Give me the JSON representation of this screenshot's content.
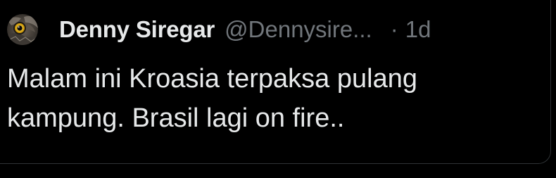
{
  "tweet": {
    "author": {
      "display_name": "Denny Siregar",
      "handle": "@Dennysire...",
      "avatar_icon": "owl-avatar-icon"
    },
    "separator": "·",
    "timestamp": "1d",
    "text": "Malam ini Kroasia terpaksa pulang kampung. Brasil lagi on fire.."
  },
  "colors": {
    "background": "#000000",
    "primary_text": "#e7e9ea",
    "secondary_text": "#71767b",
    "border": "#2f3336"
  }
}
